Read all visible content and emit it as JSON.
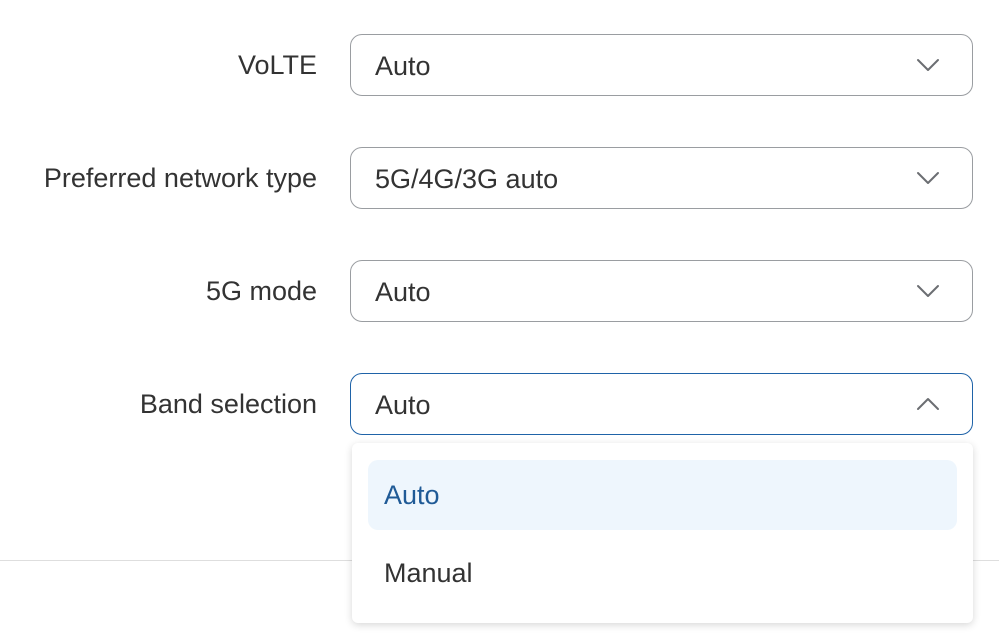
{
  "fields": {
    "volte": {
      "label": "VoLTE",
      "value": "Auto"
    },
    "network_type": {
      "label": "Preferred network type",
      "value": "5G/4G/3G auto"
    },
    "mode_5g": {
      "label": "5G mode",
      "value": "Auto"
    },
    "band_selection": {
      "label": "Band selection",
      "value": "Auto",
      "options": [
        "Auto",
        "Manual"
      ],
      "selected_option": "Auto"
    }
  },
  "icons": {
    "closed": "chevron-down-icon",
    "open": "chevron-up-icon"
  },
  "colors": {
    "focus_border": "#1f63a8",
    "selected_option_bg": "#eef6fd",
    "selected_option_text": "#1f5a96"
  }
}
